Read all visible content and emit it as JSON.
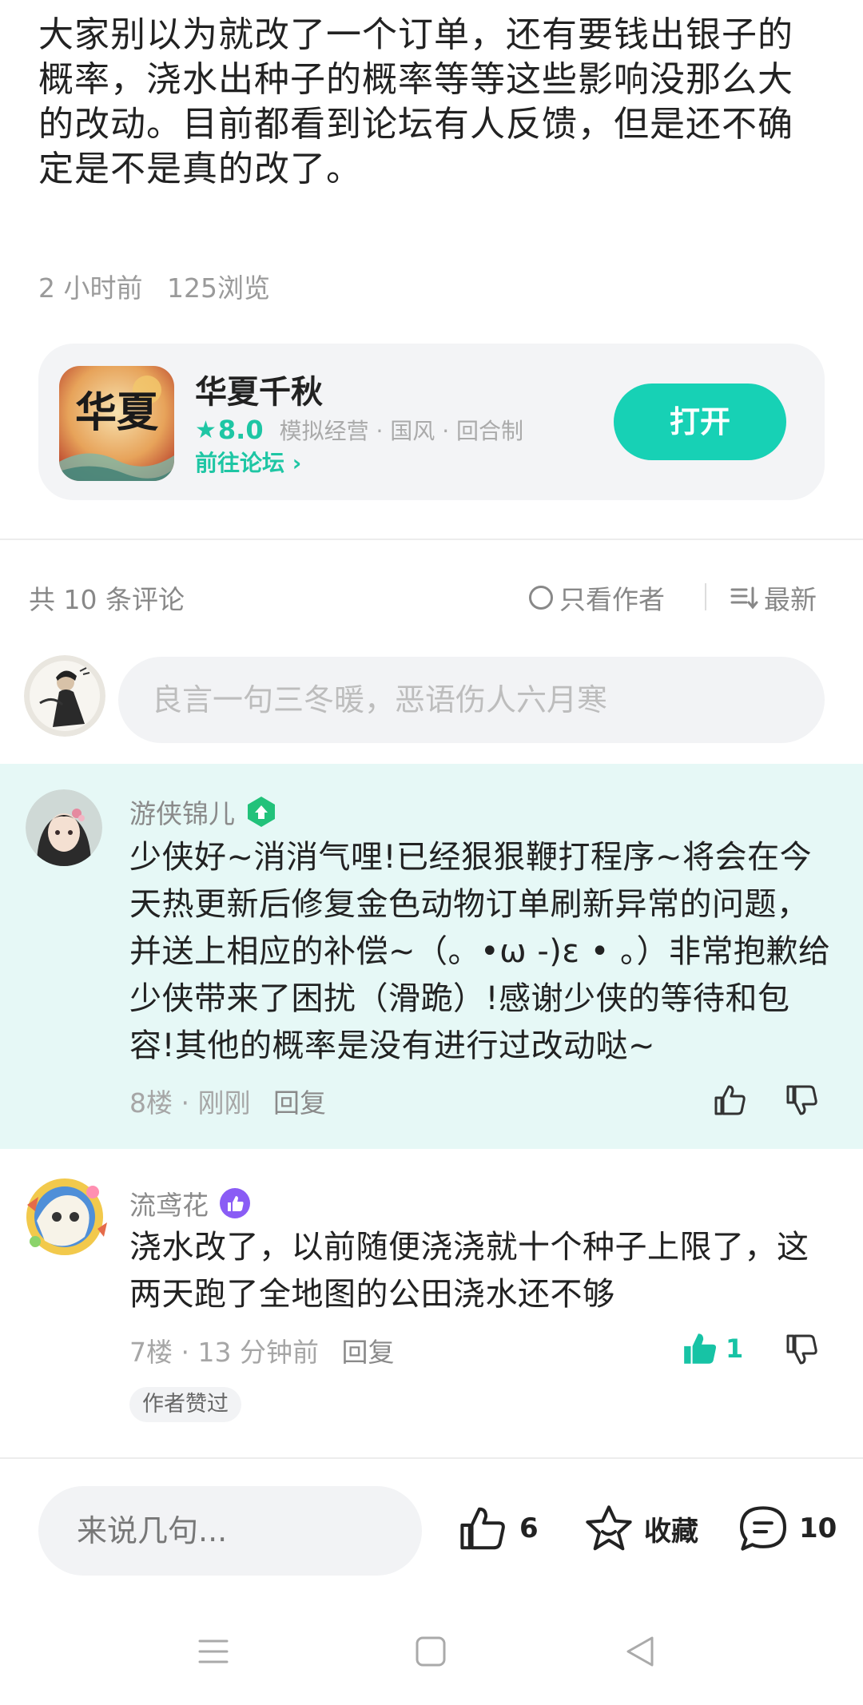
{
  "post": {
    "text": "大家别以为就改了一个订单，还有要钱出银子的概率，浇水出种子的概率等等这些影响没那么大的改动。目前都看到论坛有人反馈，但是还不确定是不是真的改了。",
    "time": "2 小时前",
    "views": "125浏览"
  },
  "game_card": {
    "name": "华夏千秋",
    "rating": "8.0",
    "tags": "模拟经营 · 国风 · 回合制",
    "forum_link": "前往论坛",
    "open_label": "打开",
    "icon_text": "华夏"
  },
  "comments_header": {
    "count": "共 10 条评论",
    "only_author": "只看作者",
    "sort": "最新"
  },
  "comment_input": {
    "placeholder": "良言一句三冬暖，恶语伤人六月寒"
  },
  "comments": [
    {
      "name": "游侠锦儿",
      "text": "少侠好~消消气哩!已经狠狠鞭打程序~将会在今天热更新后修复金色动物订单刷新异常的问题，并送上相应的补偿~（。•ω -)ε •  。）非常抱歉给少侠带来了困扰（滑跪）!感谢少侠的等待和包容!其他的概率是没有进行过改动哒~",
      "floor": "8楼 · 刚刚",
      "reply": "回复"
    },
    {
      "name": "流鸢花",
      "text": "浇水改了，以前随便浇浇就十个种子上限了，这两天跑了全地图的公田浇水还不够",
      "floor": "7楼 · 13 分钟前",
      "reply": "回复",
      "likes": "1",
      "author_liked": "作者赞过"
    }
  ],
  "bottom_bar": {
    "input_placeholder": "来说几句...",
    "likes": "6",
    "favorite": "收藏",
    "comments": "10"
  },
  "colors": {
    "accent": "#17d1b5",
    "official_bg": "#e6f8f6",
    "muted": "#9a9a9a"
  }
}
